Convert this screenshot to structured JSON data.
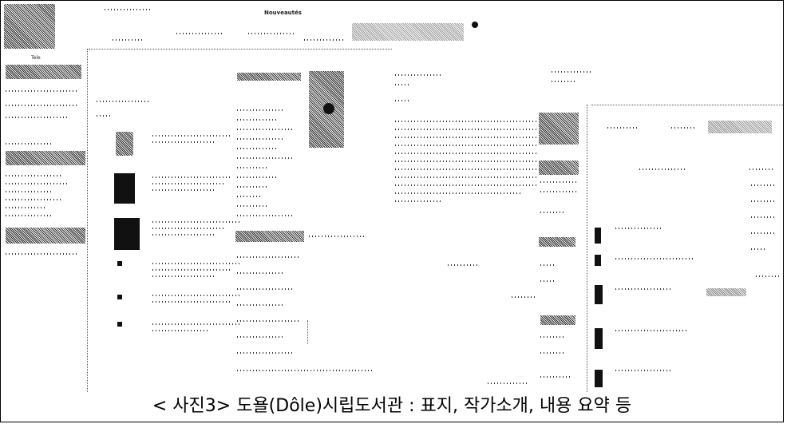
{
  "caption": "< 사진3> 도욜(Dôle)시립도서관 : 표지, 작가소개, 내용 요약 등",
  "screenshot": {
    "site_name": "Nouveautés",
    "left_label": "Tele"
  }
}
